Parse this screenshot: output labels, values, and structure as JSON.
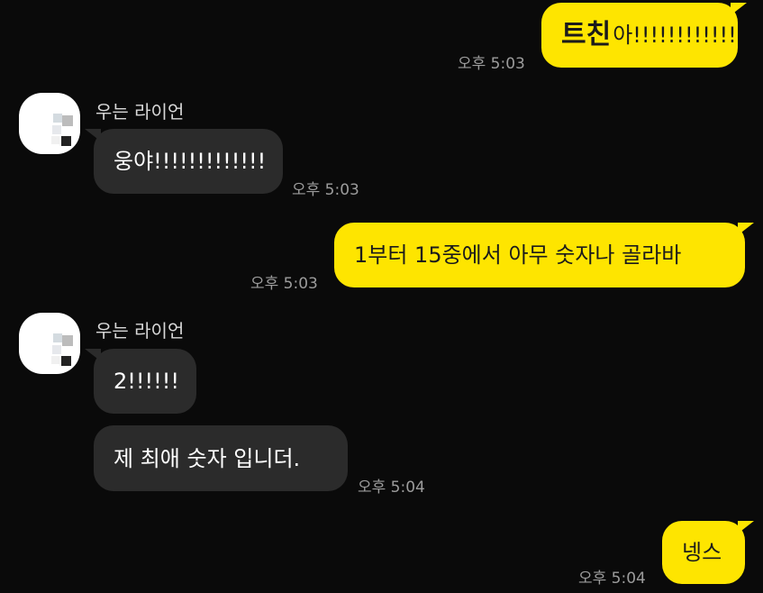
{
  "messages": [
    {
      "sender": "me",
      "sticker_text": "트친",
      "text": "아!!!!!!!!!!!!",
      "time": "오후 5:03"
    },
    {
      "sender": "them",
      "name": "우는 라이언",
      "text": "웅야!!!!!!!!!!!!!",
      "time": "오후 5:03"
    },
    {
      "sender": "me",
      "text": "1부터 15중에서 아무 숫자나 골라바",
      "time": "오후 5:03"
    },
    {
      "sender": "them",
      "name": "우는 라이언",
      "text": "2!!!!!!",
      "time": ""
    },
    {
      "sender": "them",
      "text": "제 최애 숫자 입니더.",
      "time": "오후 5:04"
    },
    {
      "sender": "me",
      "text": "넹스",
      "time": "오후 5:04"
    }
  ],
  "colors": {
    "background": "#0a0a0a",
    "my_bubble": "#fee500",
    "their_bubble": "#2b2b2b",
    "timestamp": "#9c9c9c"
  },
  "icons": {
    "avatar": "pixelated-profile-avatar"
  }
}
